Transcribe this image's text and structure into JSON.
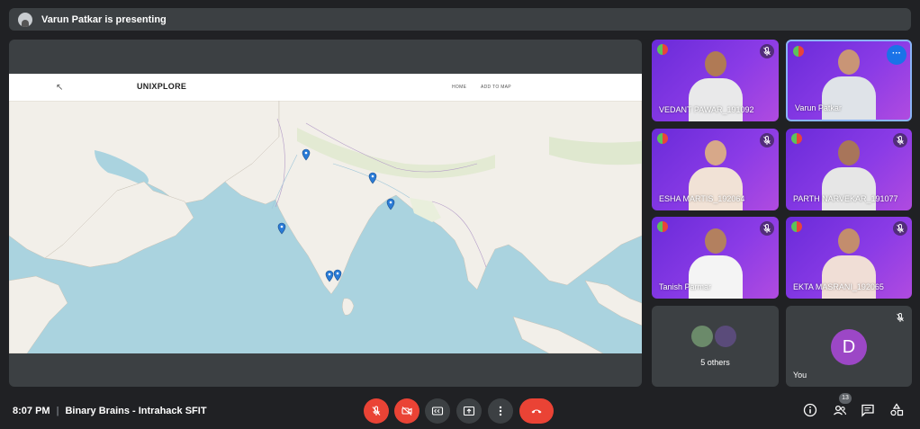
{
  "presenting": {
    "label": "Varun Patkar is presenting"
  },
  "shared_site": {
    "brand": "UNIXPLORE",
    "nav": {
      "home": "HOME",
      "add": "ADD TO MAP"
    }
  },
  "participants": [
    {
      "name": "VEDANT PAWAR_191092",
      "skin": "#b07a55",
      "shirt": "#e9e9ea"
    },
    {
      "name": "Varun Patkar",
      "skin": "#c99576",
      "shirt": "#dfe3e8"
    },
    {
      "name": "ESHA MARTIS_192064",
      "skin": "#d7a889",
      "shirt": "#f1e2d6"
    },
    {
      "name": "PARTH NARVEKAR_191077",
      "skin": "#a8755a",
      "shirt": "#e6e6e6"
    },
    {
      "name": "Tanish Parmar",
      "skin": "#b3805f",
      "shirt": "#f4f4f4"
    },
    {
      "name": "EKTA MASRANI_192065",
      "skin": "#c38d6d",
      "shirt": "#f0ded6"
    }
  ],
  "others": {
    "label": "5 others"
  },
  "self": {
    "label": "You",
    "initial": "D"
  },
  "meeting": {
    "time": "8:07 PM",
    "separator": "|",
    "name": "Binary Brains - Intrahack SFIT"
  },
  "people_count": "13",
  "colors": {
    "background": "#202124",
    "tile": "#3c4043",
    "accent": "#8ab4f8",
    "danger": "#ea4335",
    "participant_bg": "#7b33e0"
  },
  "icons": [
    "presenter-avatar-icon",
    "mic-off-icon",
    "cam-off-icon",
    "captions-icon",
    "present-icon",
    "more-vert-icon",
    "end-call-icon",
    "info-icon",
    "people-icon",
    "chat-icon",
    "activities-icon",
    "map-pin-icon"
  ]
}
